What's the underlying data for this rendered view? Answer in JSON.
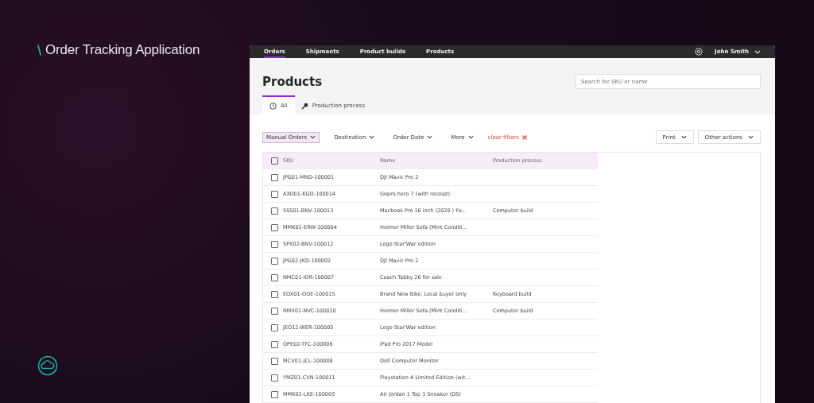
{
  "brand": {
    "title": "Order Tracking Application"
  },
  "nav": {
    "items": [
      {
        "label": "Orders",
        "selected": true
      },
      {
        "label": "Shipments",
        "selected": false
      },
      {
        "label": "Product builds",
        "selected": false
      },
      {
        "label": "Products",
        "selected": false
      }
    ],
    "user": "John Smith"
  },
  "page": {
    "title": "Products",
    "search": {
      "placeholder": "Search for SKU or name"
    }
  },
  "tabs": [
    {
      "label": "All",
      "kind": "clock",
      "selected": true
    },
    {
      "label": "Production process",
      "kind": "wrench",
      "selected": false
    }
  ],
  "filters": [
    {
      "label": "Manual Orders",
      "selected": true
    },
    {
      "label": "Destination",
      "selected": false
    },
    {
      "label": "Order Date",
      "selected": false
    },
    {
      "label": "More",
      "selected": false
    }
  ],
  "clear_filters": "clear filters",
  "actions": [
    "Print",
    "Other actions"
  ],
  "table": {
    "select_all_checked": false,
    "columns": [
      "SKU",
      "Name",
      "Production process"
    ],
    "rows": [
      {
        "sku": "JPG01-MND-100001",
        "name": "DJI Mavic Pro 2",
        "process": "",
        "checked": false
      },
      {
        "sku": "AXO01-KGO-100014",
        "name": "Gopro hero 7 (with receipt)",
        "process": "",
        "checked": false
      },
      {
        "sku": "SSS01-BNV-100013",
        "name": "Macbook Pro 16 inch (2020 ) Fo...",
        "process": "Computer build",
        "checked": false
      },
      {
        "sku": "MMK01-ERW-100004",
        "name": "Heimer Miller Sofa (Mint Conditi...",
        "process": "",
        "checked": false
      },
      {
        "sku": "SPX02-BNV-100012",
        "name": "Lego Star'War edition",
        "process": "",
        "checked": false
      },
      {
        "sku": "JPG02-JKD-100002",
        "name": "DJI Mavic Pro 2",
        "process": "",
        "checked": false
      },
      {
        "sku": "NMC01-IOR-100007",
        "name": "Coach Tabby 26 for sale",
        "process": "",
        "checked": false
      },
      {
        "sku": "EOX01-OOE-100015",
        "name": "Brand New Bike, Local buyer only",
        "process": "Keyboard build",
        "checked": false
      },
      {
        "sku": "NMX01-NVC-100010",
        "name": "Heimer Miller Sofa (Mint Conditi...",
        "process": "Computer build",
        "checked": false
      },
      {
        "sku": "JEO12-WER-100005",
        "name": "Lego Star'War edition",
        "process": "",
        "checked": false
      },
      {
        "sku": "OPE02-TFC-100006",
        "name": "iPad Pro 2017 Model",
        "process": "",
        "checked": false
      },
      {
        "sku": "MCV01-JCL-100008",
        "name": "Dell Computer Monitor",
        "process": "",
        "checked": false
      },
      {
        "sku": "YMZ01-CVN-100011",
        "name": "Playstation 4 Limited Edition (wit...",
        "process": "",
        "checked": false
      },
      {
        "sku": "MMK02-LKE-100003",
        "name": "Air Jordan 1 Top 3 Sneaker (DS)",
        "process": "",
        "checked": false
      }
    ]
  }
}
